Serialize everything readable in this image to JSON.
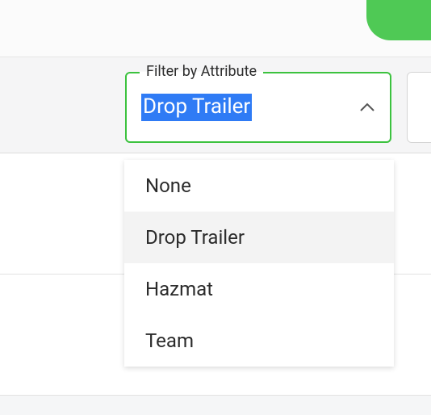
{
  "filter": {
    "label": "Filter by Attribute",
    "selected": "Drop Trailer",
    "options": [
      "None",
      "Drop Trailer",
      "Hazmat",
      "Team"
    ],
    "highlighted_index": 1,
    "expanded": true
  },
  "colors": {
    "accent_green": "#3cc23f",
    "pill_green": "#4fc955",
    "selection_blue": "#2f7bf5"
  }
}
